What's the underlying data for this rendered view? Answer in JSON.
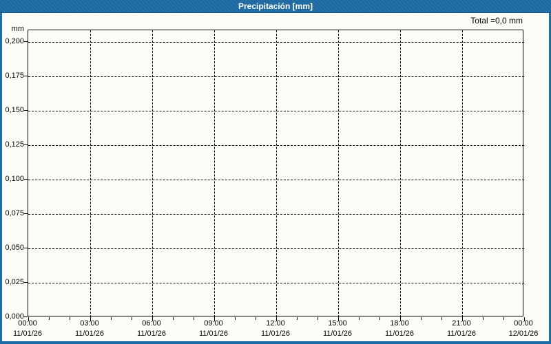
{
  "colors": {
    "header_bg": "#1d6ba4",
    "header_edge": "#14517e",
    "header_text": "#ffffff",
    "frame": "#1d6ba4",
    "canvas_bg": "#fcfdf7",
    "axis": "#000000",
    "grid": "#000000",
    "label_text": "#000000"
  },
  "header": {
    "title": "Precipitación [mm]"
  },
  "chart_data": {
    "type": "bar",
    "title": "Precipitación [mm]",
    "ylabel": "mm",
    "xlabel": "",
    "total_text": "Total =0,0 mm",
    "total_value_mm": 0.0,
    "ylim": [
      0,
      0.2085
    ],
    "grid": "dashed, both axes",
    "legend": "none",
    "decimal_separator": ",",
    "y_ticks": [
      {
        "label": "0,200",
        "value": 0.2
      },
      {
        "label": "0,175",
        "value": 0.175
      },
      {
        "label": "0,150",
        "value": 0.15
      },
      {
        "label": "0,125",
        "value": 0.125
      },
      {
        "label": "0,100",
        "value": 0.1
      },
      {
        "label": "0,075",
        "value": 0.075
      },
      {
        "label": "0,050",
        "value": 0.05
      },
      {
        "label": "0,025",
        "value": 0.025
      },
      {
        "label": "0,000",
        "value": 0.0
      }
    ],
    "x_ticks": [
      {
        "time": "00:00",
        "date": "11/01/26"
      },
      {
        "time": "03:00",
        "date": "11/01/26"
      },
      {
        "time": "06:00",
        "date": "11/01/26"
      },
      {
        "time": "09:00",
        "date": "11/01/26"
      },
      {
        "time": "12:00",
        "date": "11/01/26"
      },
      {
        "time": "15:00",
        "date": "11/01/26"
      },
      {
        "time": "18:00",
        "date": "11/01/26"
      },
      {
        "time": "21:00",
        "date": "11/01/26"
      },
      {
        "time": "00:00",
        "date": "12/01/26"
      }
    ],
    "minor_ticks_per_major": 3,
    "series": [
      {
        "name": "Precipitación",
        "values": [],
        "note_visible_total": "0,0"
      }
    ]
  }
}
